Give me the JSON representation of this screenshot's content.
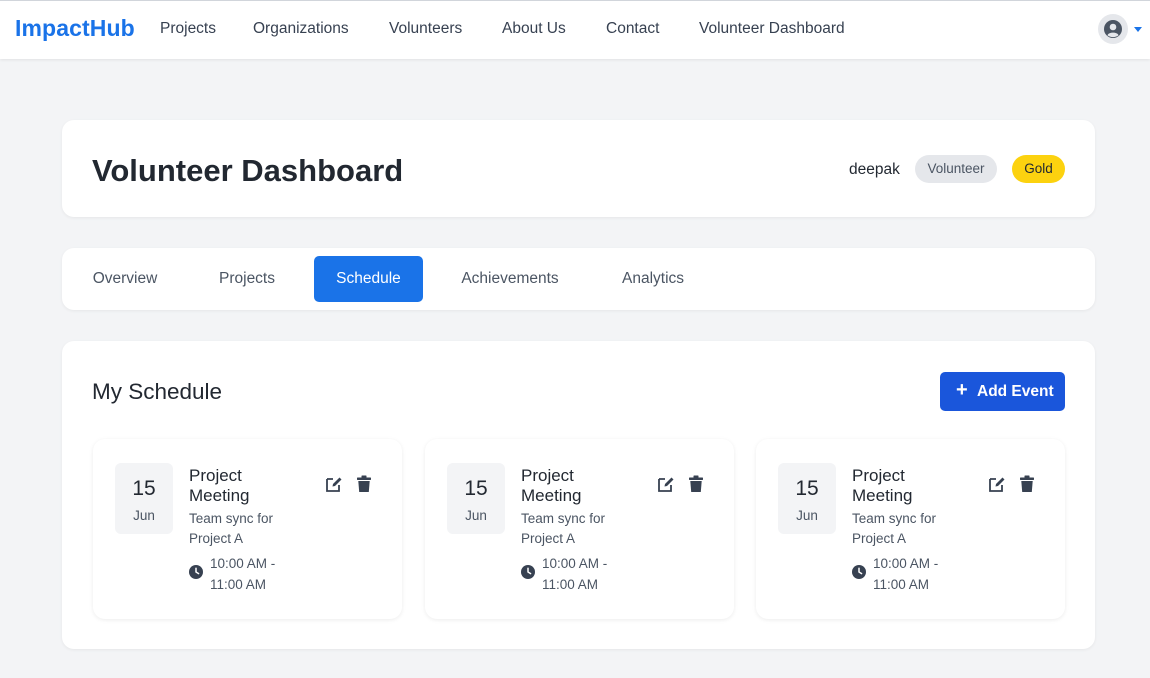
{
  "navbar": {
    "brand": "ImpactHub",
    "links": [
      "Projects",
      "Organizations",
      "Volunteers",
      "About Us",
      "Contact",
      "Volunteer Dashboard"
    ],
    "user_icon": "user-circle-icon",
    "caret_icon": "caret-down-icon"
  },
  "header": {
    "title": "Volunteer Dashboard",
    "username": "deepak",
    "role_badge": "Volunteer",
    "tier_badge": "Gold"
  },
  "tabs": {
    "items": [
      "Overview",
      "Projects",
      "Schedule",
      "Achievements",
      "Analytics"
    ],
    "active": "Schedule"
  },
  "schedule": {
    "title": "My Schedule",
    "add_button": "Add Event",
    "events": [
      {
        "day": "15",
        "month": "Jun",
        "title": "Project Meeting",
        "description": "Team sync for Project A",
        "time": "10:00 AM - 11:00 AM"
      },
      {
        "day": "15",
        "month": "Jun",
        "title": "Project Meeting",
        "description": "Team sync for Project A",
        "time": "10:00 AM - 11:00 AM"
      },
      {
        "day": "15",
        "month": "Jun",
        "title": "Project Meeting",
        "description": "Team sync for Project A",
        "time": "10:00 AM - 11:00 AM"
      }
    ]
  },
  "colors": {
    "accent": "#1a73e8",
    "add_button": "#1a56db",
    "gold_badge": "#fcd20f",
    "background": "#f3f4f6"
  }
}
